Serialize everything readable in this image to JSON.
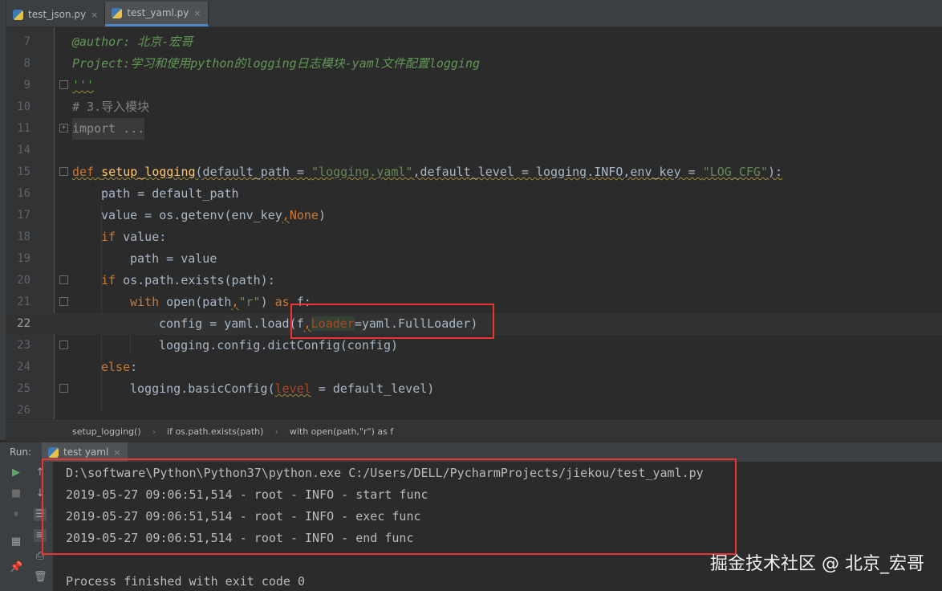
{
  "tabs": [
    {
      "label": "test_json.py",
      "close": "×"
    },
    {
      "label": "test_yaml.py",
      "close": "×"
    }
  ],
  "lines": [
    {
      "num": "7"
    },
    {
      "num": "8"
    },
    {
      "num": "9"
    },
    {
      "num": "10"
    },
    {
      "num": "11"
    },
    {
      "num": "14"
    },
    {
      "num": "15"
    },
    {
      "num": "16"
    },
    {
      "num": "17"
    },
    {
      "num": "18"
    },
    {
      "num": "19"
    },
    {
      "num": "20"
    },
    {
      "num": "21"
    },
    {
      "num": "22"
    },
    {
      "num": "23"
    },
    {
      "num": "24"
    },
    {
      "num": "25"
    },
    {
      "num": "26"
    }
  ],
  "code": {
    "l7": "@author: 北京-宏哥",
    "l8": "Project:学习和使用python的logging日志模块-yaml文件配置logging",
    "l9": "'''",
    "l10": "# 3.导入模块",
    "l11": "import ...",
    "l15_def": "def",
    "l15_name": "setup_logging",
    "l15_a": "(default_path = ",
    "l15_s1": "\"logging.yaml\"",
    "l15_b": ",default_level = logging.INFO,env_key = ",
    "l15_s2": "\"LOG_CFG\"",
    "l15_c": "):",
    "l16": "path = default_path",
    "l17_a": "value = os.getenv(env_key",
    "l17_comma": ",",
    "l17_none": "None",
    "l17_c": ")",
    "l18_if": "if",
    "l18_rest": " value:",
    "l19": "path = value",
    "l20_if": "if",
    "l20_rest": " os.path.exists(path):",
    "l21_with": "with",
    "l21_a": " open(path",
    "l21_comma": ",",
    "l21_s": "\"r\"",
    "l21_b": ") ",
    "l21_as": "as",
    "l21_c": " f:",
    "l22_a": "config = yaml.load(f",
    "l22_comma": ",",
    "l22_kw": "Loader",
    "l22_b": "=yaml.FullLoader)",
    "l23": "logging.config.dictConfig(config)",
    "l24_else": "else",
    "l24_colon": ":",
    "l25_a": "logging.basicConfig(",
    "l25_kw": "level",
    "l25_b": " = default_level)"
  },
  "breadcrumb": [
    "setup_logging()",
    "if os.path.exists(path)",
    "with open(path,\"r\") as f"
  ],
  "run": {
    "label": "Run:",
    "tab": "test yaml",
    "close": "×",
    "output": [
      "D:\\software\\Python\\Python37\\python.exe C:/Users/DELL/PycharmProjects/jiekou/test_yaml.py",
      "2019-05-27 09:06:51,514 - root - INFO - start func",
      "2019-05-27 09:06:51,514 - root - INFO - exec func",
      "2019-05-27 09:06:51,514 - root - INFO - end func",
      "",
      "Process finished with exit code 0"
    ]
  },
  "watermark": "掘金技术社区 @ 北京_宏哥",
  "colors": {
    "highlight": "#ee3333",
    "keyword": "#cc7832",
    "function": "#ffc66d",
    "string": "#6a8759"
  },
  "icons": [
    "python-file-icon",
    "run-icon",
    "stop-icon",
    "pause-icon",
    "up-arrow-icon",
    "down-arrow-icon",
    "soft-wrap-icon",
    "scroll-end-icon",
    "layout-icon",
    "print-icon",
    "pin-icon",
    "trash-icon"
  ]
}
